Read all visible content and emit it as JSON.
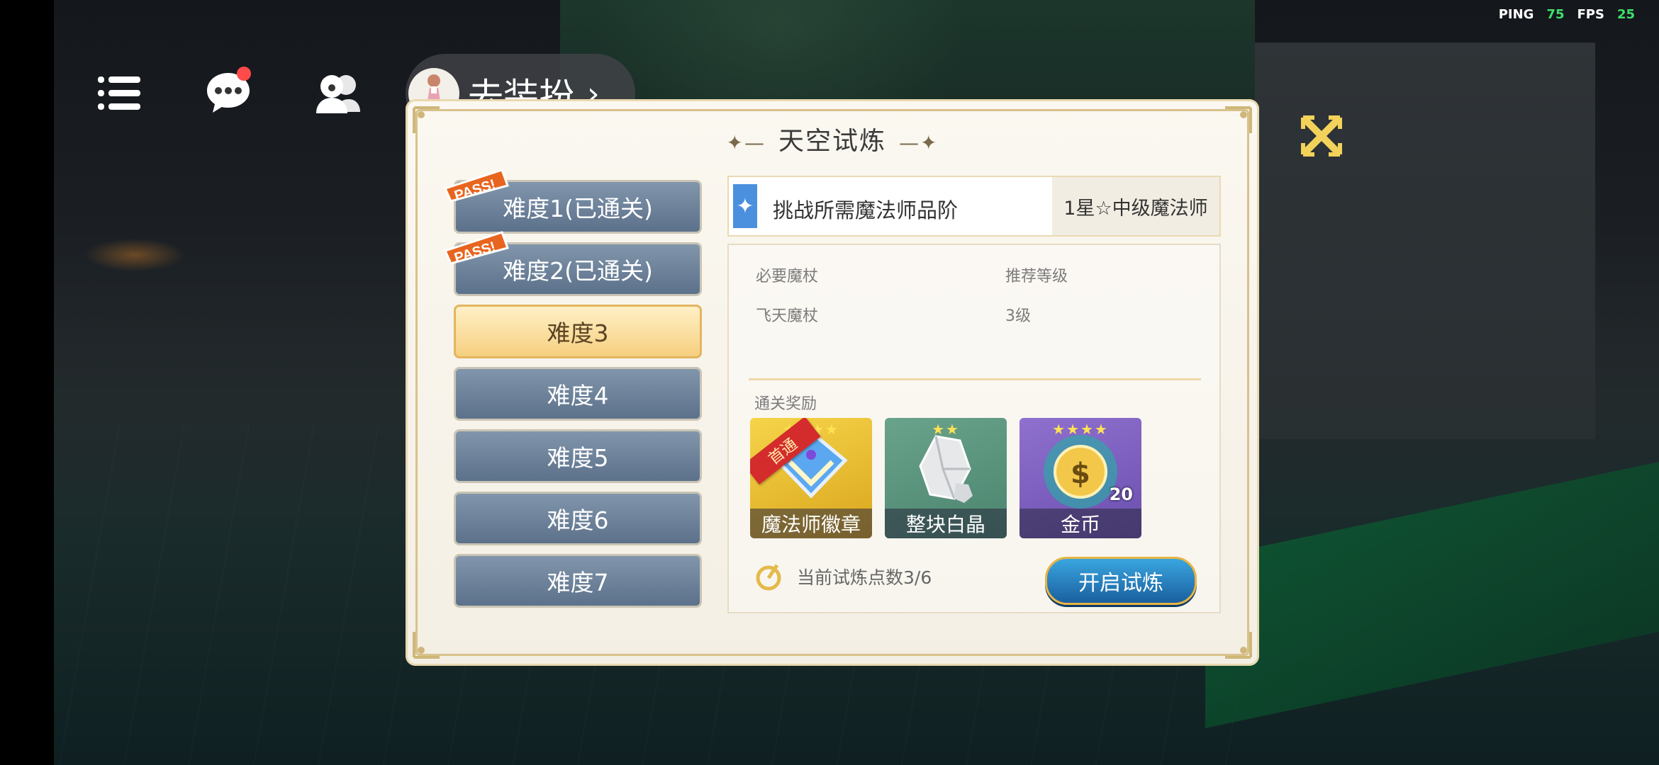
{
  "hud": {
    "ping_label": "PING",
    "ping_value": "75",
    "fps_label": "FPS",
    "fps_value": "25"
  },
  "topbar": {
    "dress_up_label": "去装扮"
  },
  "panel": {
    "title": "天空试炼",
    "pass_badge": "PASS!",
    "difficulties": [
      {
        "label": "难度1(已通关)",
        "passed": true
      },
      {
        "label": "难度2(已通关)",
        "passed": true
      },
      {
        "label": "难度3",
        "selected": true
      },
      {
        "label": "难度4"
      },
      {
        "label": "难度5"
      },
      {
        "label": "难度6"
      },
      {
        "label": "难度7"
      }
    ],
    "requirement": {
      "label": "挑战所需魔法师品阶",
      "value": "1星☆中级魔法师"
    },
    "info": {
      "wand_label": "必要魔杖",
      "wand_value": "飞天魔杖",
      "level_label": "推荐等级",
      "level_value": "3级"
    },
    "rewards_title": "通关奖励",
    "rewards": [
      {
        "name": "魔法师徽章",
        "ribbon": "首通",
        "icon": "badge-icon"
      },
      {
        "name": "整块白晶",
        "icon": "crystal-icon"
      },
      {
        "name": "金币",
        "count": "20",
        "icon": "coin-icon"
      }
    ],
    "trial_points": "当前试炼点数3/6",
    "start_button": "开启试炼"
  },
  "colors": {
    "accent": "#f6cf7f",
    "panel_bg": "#fbf8f1",
    "button_blue": "#1a5f9e",
    "hud_green": "#3ee06a"
  }
}
